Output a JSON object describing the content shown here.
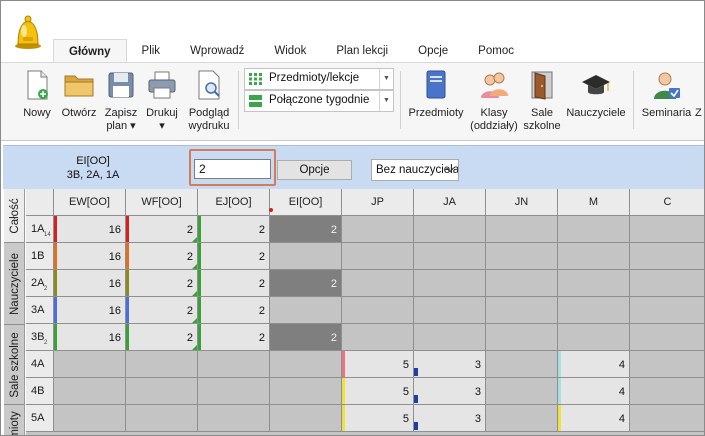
{
  "tabs": [
    {
      "label": "Główny",
      "active": true
    },
    {
      "label": "Plik"
    },
    {
      "label": "Wprowadź"
    },
    {
      "label": "Widok"
    },
    {
      "label": "Plan lekcji"
    },
    {
      "label": "Opcje"
    },
    {
      "label": "Pomoc"
    }
  ],
  "ribbon": {
    "new": "Nowy",
    "open": "Otwórz",
    "save": "Zapisz\nplan ▾",
    "print": "Drukuj\n▾",
    "preview": "Podgląd\nwydruku",
    "view_combo": "Przedmioty/lekcje",
    "week_combo": "Połączone tygodnie",
    "subjects": "Przedmioty",
    "classes": "Klasy\n(oddziały)",
    "rooms": "Sale\nszkolne",
    "teachers": "Nauczyciele",
    "seminars": "Seminaria",
    "extra": "Z"
  },
  "filter": {
    "selected_line1": "EI[OO]",
    "selected_line2": "3B, 2A, 1A",
    "search_value": "2",
    "options_label": "Opcje",
    "teacher_filter": "Bez nauczyciela"
  },
  "side_tabs": [
    "Całość",
    "Nauczyciele",
    "Sale szkolne",
    "mioty"
  ],
  "grid": {
    "columns": [
      "EW[OO]",
      "WF[OO]",
      "EJ[OO]",
      "EI[OO]",
      "JP",
      "JA",
      "JN",
      "M",
      "C"
    ],
    "rows": [
      {
        "label": "1A",
        "sub": "14",
        "cells": [
          "16",
          "2",
          "2",
          "2",
          "",
          "",
          "",
          "",
          ""
        ]
      },
      {
        "label": "1B",
        "sub": "",
        "cells": [
          "16",
          "2",
          "2",
          "",
          "",
          "",
          "",
          "",
          ""
        ]
      },
      {
        "label": "2A",
        "sub": "2",
        "cells": [
          "16",
          "2",
          "2",
          "2",
          "",
          "",
          "",
          "",
          ""
        ]
      },
      {
        "label": "3A",
        "sub": "",
        "cells": [
          "16",
          "2",
          "2",
          "",
          "",
          "",
          "",
          "",
          ""
        ]
      },
      {
        "label": "3B",
        "sub": "2",
        "cells": [
          "16",
          "2",
          "2",
          "2",
          "",
          "",
          "",
          "",
          ""
        ]
      },
      {
        "label": "4A",
        "sub": "",
        "cells": [
          "",
          "",
          "",
          "",
          "5",
          "3",
          "",
          "4",
          ""
        ]
      },
      {
        "label": "4B",
        "sub": "",
        "cells": [
          "",
          "",
          "",
          "",
          "5",
          "3",
          "",
          "4",
          ""
        ]
      },
      {
        "label": "5A",
        "sub": "",
        "cells": [
          "",
          "",
          "",
          "",
          "5",
          "3",
          "",
          "4",
          ""
        ]
      }
    ]
  },
  "colors": {
    "accent_blue": "#c9daf3",
    "highlight_box": "#d57b58",
    "dark_cell": "#7f7f7f",
    "marker_red": "#d82020",
    "marker_orange": "#e07020",
    "marker_green": "#38a238",
    "marker_olive": "#8b8b1a",
    "marker_blue": "#4a6ee0",
    "marker_pink": "#f07080",
    "marker_yellow": "#f0e040",
    "marker_cyan": "#a8e0e0",
    "bar_blue": "#1c3fa6"
  }
}
